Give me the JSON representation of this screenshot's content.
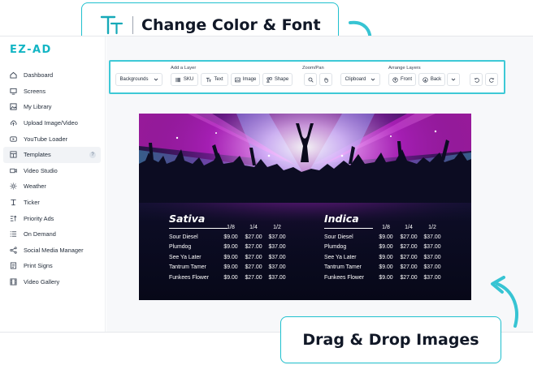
{
  "callouts": {
    "font": {
      "text": "Change Color & Font",
      "icon": "text-format-icon"
    },
    "drag": {
      "text": "Drag & Drop Images"
    }
  },
  "app": {
    "logo": "EZ-AD"
  },
  "sidebar": {
    "items": [
      {
        "label": "Dashboard",
        "icon": "home-icon"
      },
      {
        "label": "Screens",
        "icon": "monitor-icon"
      },
      {
        "label": "My Library",
        "icon": "image-icon"
      },
      {
        "label": "Upload Image/Video",
        "icon": "upload-cloud-icon"
      },
      {
        "label": "YouTube Loader",
        "icon": "youtube-icon"
      },
      {
        "label": "Templates",
        "icon": "template-icon",
        "badge": "?"
      },
      {
        "label": "Video Studio",
        "icon": "video-icon"
      },
      {
        "label": "Weather",
        "icon": "sun-icon"
      },
      {
        "label": "Ticker",
        "icon": "ticker-icon"
      },
      {
        "label": "Priority Ads",
        "icon": "priority-icon"
      },
      {
        "label": "On Demand",
        "icon": "list-icon"
      },
      {
        "label": "Social Media Manager",
        "icon": "share-icon"
      },
      {
        "label": "Print Signs",
        "icon": "print-icon"
      },
      {
        "label": "Video Gallery",
        "icon": "film-icon"
      }
    ]
  },
  "toolbar": {
    "backgrounds": "Backgrounds",
    "add_layer_label": "Add a Layer",
    "sku": "SKU",
    "text": "Text",
    "image": "Image",
    "shape": "Shape",
    "zoom_pan_label": "Zoom/Pan",
    "clipboard": "Clipboard",
    "arrange_label": "Arrange Layers",
    "front": "Front",
    "back": "Back"
  },
  "menu": {
    "sizes": [
      "1/8",
      "1/4",
      "1/2"
    ],
    "sections": [
      {
        "title": "Sativa",
        "rows": [
          {
            "name": "Sour Diesel",
            "prices": [
              "$9.00",
              "$27.00",
              "$37.00"
            ]
          },
          {
            "name": "Plumdog",
            "prices": [
              "$9.00",
              "$27.00",
              "$37.00"
            ]
          },
          {
            "name": "See Ya Later",
            "prices": [
              "$9.00",
              "$27.00",
              "$37.00"
            ]
          },
          {
            "name": "Tantrum Tamer",
            "prices": [
              "$9.00",
              "$27.00",
              "$37.00"
            ]
          },
          {
            "name": "Funkees Flower",
            "prices": [
              "$9.00",
              "$27.00",
              "$37.00"
            ]
          }
        ]
      },
      {
        "title": "Indica",
        "rows": [
          {
            "name": "Sour Diesel",
            "prices": [
              "$9.00",
              "$27.00",
              "$37.00"
            ]
          },
          {
            "name": "Plumdog",
            "prices": [
              "$9.00",
              "$27.00",
              "$37.00"
            ]
          },
          {
            "name": "See Ya Later",
            "prices": [
              "$9.00",
              "$27.00",
              "$37.00"
            ]
          },
          {
            "name": "Tantrum Tamer",
            "prices": [
              "$9.00",
              "$27.00",
              "$37.00"
            ]
          },
          {
            "name": "Funkees Flower",
            "prices": [
              "$9.00",
              "$27.00",
              "$37.00"
            ]
          }
        ]
      }
    ]
  },
  "colors": {
    "accent": "#20c1cf",
    "brand": "#13b5c4",
    "stage_magenta": "#e022c8",
    "stage_cyan": "#3fd8ee"
  }
}
